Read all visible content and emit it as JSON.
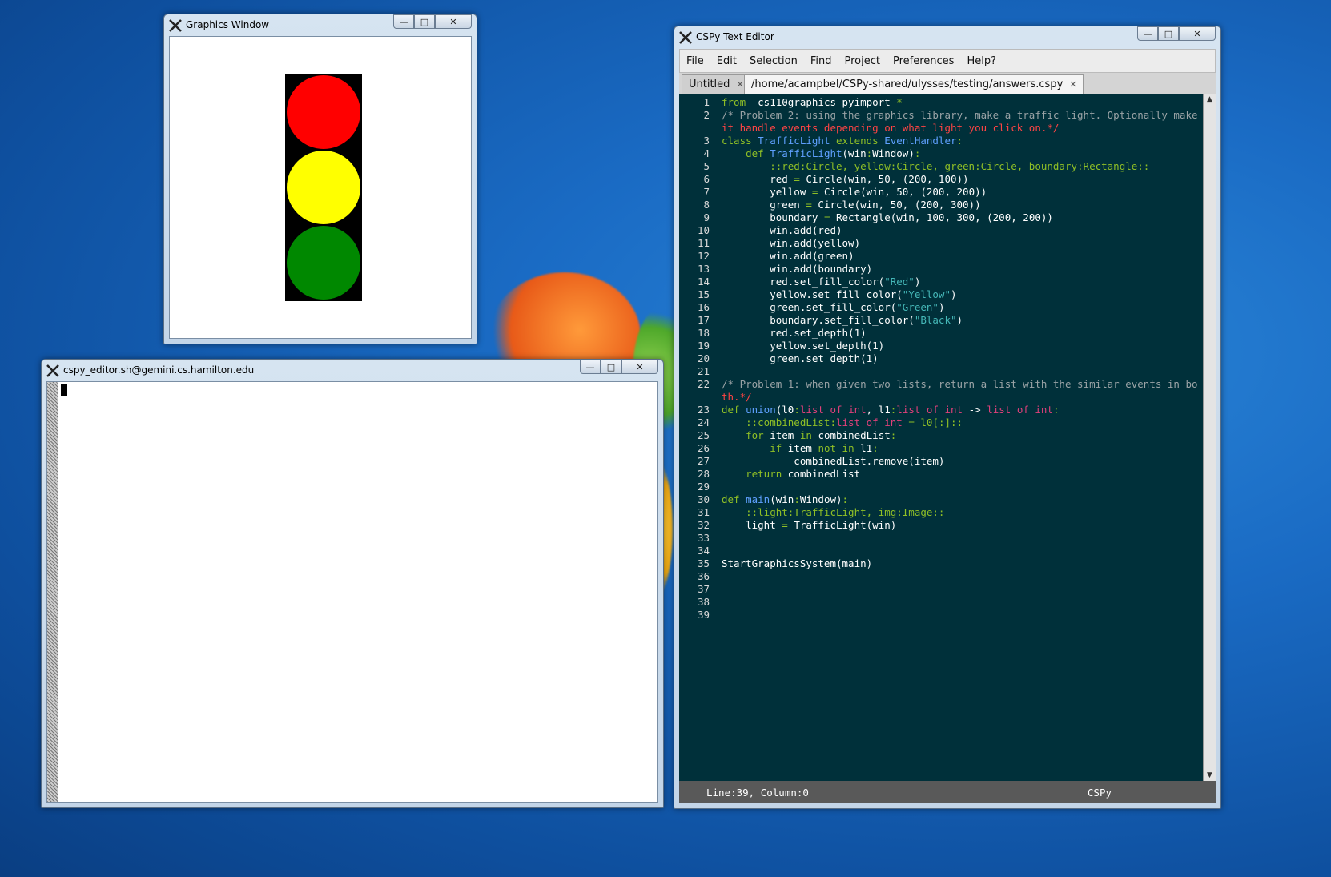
{
  "graphics_window": {
    "title": "Graphics Window",
    "lights": [
      {
        "name": "red",
        "color": "#ff0000"
      },
      {
        "name": "yellow",
        "color": "#ffff00"
      },
      {
        "name": "green",
        "color": "#008800"
      }
    ]
  },
  "terminal_window": {
    "title": "cspy_editor.sh@gemini.cs.hamilton.edu"
  },
  "editor_window": {
    "title": "CSPy Text Editor",
    "menu": [
      "File",
      "Edit",
      "Selection",
      "Find",
      "Project",
      "Preferences",
      "Help?"
    ],
    "tabs": [
      {
        "label": "Untitled",
        "active": false
      },
      {
        "label": "/home/acampbel/CSPy-shared/ulysses/testing/answers.cspy",
        "active": true
      }
    ],
    "status": {
      "position": "Line:39, Column:0",
      "language": "CSPy"
    },
    "code_lines": [
      {
        "n": "1",
        "parts": [
          [
            "kw",
            "from"
          ],
          [
            "",
            "  cs110graphics pyimport "
          ],
          [
            "op",
            "*"
          ]
        ]
      },
      {
        "n": "2",
        "parts": [
          [
            "cmt",
            "/* Problem 2: using the graphics library, make a traffic light. Optionally make"
          ]
        ]
      },
      {
        "n": "",
        "parts": [
          [
            "red",
            "it handle events depending on what light you click on.*/"
          ]
        ]
      },
      {
        "n": "3",
        "parts": [
          [
            "kw",
            "class "
          ],
          [
            "def",
            "TrafficLight"
          ],
          [
            "kw",
            " extends "
          ],
          [
            "def",
            "EventHandler"
          ],
          [
            "op",
            ":"
          ]
        ]
      },
      {
        "n": "4",
        "parts": [
          [
            "",
            "    "
          ],
          [
            "kw",
            "def "
          ],
          [
            "def",
            "TrafficLight"
          ],
          [
            "",
            "(win"
          ],
          [
            "op",
            ":"
          ],
          [
            "",
            "Window)"
          ],
          [
            "op",
            ":"
          ]
        ]
      },
      {
        "n": "5",
        "parts": [
          [
            "kw",
            "        ::red:Circle, yellow:Circle, green:Circle, boundary:Rectangle::"
          ]
        ]
      },
      {
        "n": "6",
        "parts": [
          [
            "",
            "        red "
          ],
          [
            "op",
            "="
          ],
          [
            "",
            " Circle(win, 50, (200, 100))"
          ]
        ]
      },
      {
        "n": "7",
        "parts": [
          [
            "",
            "        yellow "
          ],
          [
            "op",
            "="
          ],
          [
            "",
            " Circle(win, 50, (200, 200))"
          ]
        ]
      },
      {
        "n": "8",
        "parts": [
          [
            "",
            "        green "
          ],
          [
            "op",
            "="
          ],
          [
            "",
            " Circle(win, 50, (200, 300))"
          ]
        ]
      },
      {
        "n": "9",
        "parts": [
          [
            "",
            "        boundary "
          ],
          [
            "op",
            "="
          ],
          [
            "",
            " Rectangle(win, 100, 300, (200, 200))"
          ]
        ]
      },
      {
        "n": "10",
        "parts": [
          [
            "",
            "        win.add(red)"
          ]
        ]
      },
      {
        "n": "11",
        "parts": [
          [
            "",
            "        win.add(yellow)"
          ]
        ]
      },
      {
        "n": "12",
        "parts": [
          [
            "",
            "        win.add(green)"
          ]
        ]
      },
      {
        "n": "13",
        "parts": [
          [
            "",
            "        win.add(boundary)"
          ]
        ]
      },
      {
        "n": "14",
        "parts": [
          [
            "",
            "        red.set_fill_color("
          ],
          [
            "str",
            "\"Red\""
          ],
          [
            "",
            ")"
          ]
        ]
      },
      {
        "n": "15",
        "parts": [
          [
            "",
            "        yellow.set_fill_color("
          ],
          [
            "str",
            "\"Yellow\""
          ],
          [
            "",
            ")"
          ]
        ]
      },
      {
        "n": "16",
        "parts": [
          [
            "",
            "        green.set_fill_color("
          ],
          [
            "str",
            "\"Green\""
          ],
          [
            "",
            ")"
          ]
        ]
      },
      {
        "n": "17",
        "parts": [
          [
            "",
            "        boundary.set_fill_color("
          ],
          [
            "str",
            "\"Black\""
          ],
          [
            "",
            ")"
          ]
        ]
      },
      {
        "n": "18",
        "parts": [
          [
            "",
            "        red.set_depth(1)"
          ]
        ]
      },
      {
        "n": "19",
        "parts": [
          [
            "",
            "        yellow.set_depth(1)"
          ]
        ]
      },
      {
        "n": "20",
        "parts": [
          [
            "",
            "        green.set_depth(1)"
          ]
        ]
      },
      {
        "n": "21",
        "parts": []
      },
      {
        "n": "22",
        "parts": [
          [
            "cmt",
            "/* Problem 1: when given two lists, return a list with the similar events in bo"
          ]
        ]
      },
      {
        "n": "",
        "parts": [
          [
            "red",
            "th.*/"
          ]
        ]
      },
      {
        "n": "23",
        "parts": [
          [
            "kw",
            "def "
          ],
          [
            "def",
            "union"
          ],
          [
            "",
            "(l0"
          ],
          [
            "op",
            ":"
          ],
          [
            "typ",
            "list of int"
          ],
          [
            "",
            ", l1"
          ],
          [
            "op",
            ":"
          ],
          [
            "typ",
            "list of int"
          ],
          [
            "",
            " -> "
          ],
          [
            "typ",
            "list of int"
          ],
          [
            "op",
            ":"
          ]
        ]
      },
      {
        "n": "24",
        "parts": [
          [
            "kw",
            "    ::combinedList:"
          ],
          [
            "typ",
            "list of int"
          ],
          [
            "kw",
            " = l0[:]::"
          ]
        ]
      },
      {
        "n": "25",
        "parts": [
          [
            "",
            "    "
          ],
          [
            "kw",
            "for "
          ],
          [
            "",
            "item "
          ],
          [
            "kw",
            "in "
          ],
          [
            "",
            "combinedList"
          ],
          [
            "op",
            ":"
          ]
        ]
      },
      {
        "n": "26",
        "parts": [
          [
            "",
            "        "
          ],
          [
            "kw",
            "if "
          ],
          [
            "",
            "item "
          ],
          [
            "kw",
            "not in "
          ],
          [
            "",
            "l1"
          ],
          [
            "op",
            ":"
          ]
        ]
      },
      {
        "n": "27",
        "parts": [
          [
            "",
            "            combinedList.remove(item)"
          ]
        ]
      },
      {
        "n": "28",
        "parts": [
          [
            "",
            "    "
          ],
          [
            "kw",
            "return "
          ],
          [
            "",
            "combinedList"
          ]
        ]
      },
      {
        "n": "29",
        "parts": []
      },
      {
        "n": "30",
        "parts": [
          [
            "kw",
            "def "
          ],
          [
            "def",
            "main"
          ],
          [
            "",
            "(win"
          ],
          [
            "op",
            ":"
          ],
          [
            "",
            "Window)"
          ],
          [
            "op",
            ":"
          ]
        ]
      },
      {
        "n": "31",
        "parts": [
          [
            "kw",
            "    ::light:TrafficLight, img:Image::"
          ]
        ]
      },
      {
        "n": "32",
        "parts": [
          [
            "",
            "    light "
          ],
          [
            "op",
            "="
          ],
          [
            "",
            " TrafficLight(win)"
          ]
        ]
      },
      {
        "n": "33",
        "parts": []
      },
      {
        "n": "34",
        "parts": []
      },
      {
        "n": "35",
        "parts": [
          [
            "",
            "StartGraphicsSystem(main)"
          ]
        ]
      },
      {
        "n": "36",
        "parts": []
      },
      {
        "n": "37",
        "parts": []
      },
      {
        "n": "38",
        "parts": []
      },
      {
        "n": "39",
        "parts": []
      }
    ]
  },
  "window_buttons": {
    "minimize": "—",
    "maximize": "□",
    "close": "✕"
  }
}
